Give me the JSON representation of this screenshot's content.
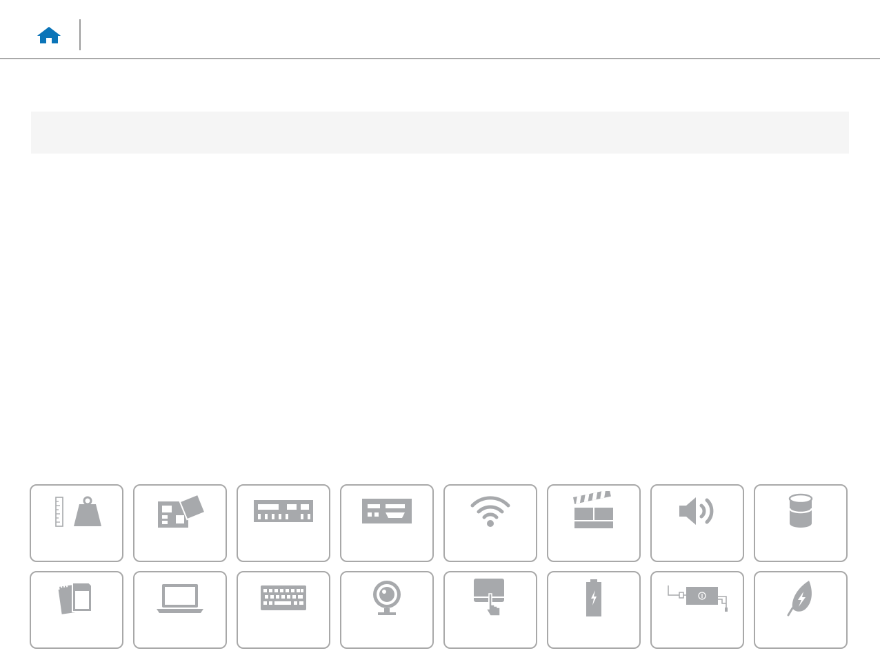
{
  "header": {
    "home_icon": "home-icon",
    "home_color": "#0a74b8"
  },
  "title_bar": {
    "text": ""
  },
  "tiles": [
    {
      "name": "dimensions-weight",
      "icon": "ruler-weight-icon",
      "label": ""
    },
    {
      "name": "system-board",
      "icon": "motherboard-icon",
      "label": ""
    },
    {
      "name": "memory",
      "icon": "memory-module-icon",
      "label": ""
    },
    {
      "name": "ports-connectors",
      "icon": "ports-icon",
      "label": ""
    },
    {
      "name": "communications",
      "icon": "wifi-icon",
      "label": ""
    },
    {
      "name": "video",
      "icon": "clapperboard-icon",
      "label": ""
    },
    {
      "name": "audio",
      "icon": "speaker-icon",
      "label": ""
    },
    {
      "name": "storage",
      "icon": "storage-cylinder-icon",
      "label": ""
    },
    {
      "name": "media-card-reader",
      "icon": "media-card-icon",
      "label": ""
    },
    {
      "name": "display",
      "icon": "laptop-icon",
      "label": ""
    },
    {
      "name": "keyboard",
      "icon": "keyboard-icon",
      "label": ""
    },
    {
      "name": "camera",
      "icon": "webcam-icon",
      "label": ""
    },
    {
      "name": "touchpad",
      "icon": "touchpad-icon",
      "label": ""
    },
    {
      "name": "battery",
      "icon": "battery-icon",
      "label": ""
    },
    {
      "name": "power-adapter",
      "icon": "power-adapter-icon",
      "label": ""
    },
    {
      "name": "environment",
      "icon": "leaf-icon",
      "label": ""
    }
  ],
  "colors": {
    "icon_gray": "#a7a9ac",
    "tile_border": "#a8a8a8",
    "title_bar_bg": "#f5f5f5"
  }
}
